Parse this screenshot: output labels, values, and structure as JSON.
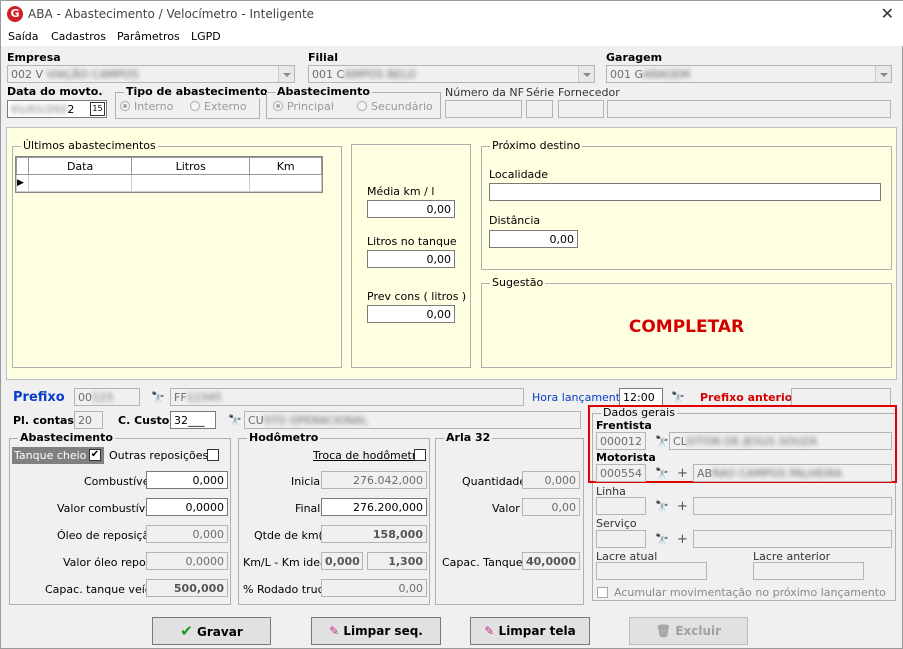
{
  "window": {
    "title": "ABA - Abastecimento / Velocímetro - Inteligente",
    "logo": "G",
    "close": "✕"
  },
  "menu": [
    "Saída",
    "Cadastros",
    "Parâmetros",
    "LGPD"
  ],
  "header": {
    "empresa_label": "Empresa",
    "empresa_value": "002 V",
    "filial_label": "Filial",
    "filial_value": "001 C",
    "garagem_label": "Garagem",
    "garagem_value": "001 G",
    "data_label": "Data do movto.",
    "data_value": "2",
    "tipo_label": "Tipo de abastecimento",
    "tipo_interno": "Interno",
    "tipo_externo": "Externo",
    "abast_label": "Abastecimento",
    "abast_principal": "Principal",
    "abast_secundario": "Secundário",
    "nf_label": "Número da NF",
    "serie_label": "Série",
    "fornecedor_label": "Fornecedor"
  },
  "ultimos": {
    "title": "Últimos abastecimentos",
    "columns": [
      "Data",
      "Litros",
      "Km"
    ]
  },
  "medias": {
    "media_label": "Média km / l",
    "media_value": "0,00",
    "litros_label": "Litros no tanque",
    "litros_value": "0,00",
    "prev_label": "Prev cons ( litros )",
    "prev_value": "0,00"
  },
  "destino": {
    "title": "Próximo destino",
    "localidade_label": "Localidade",
    "distancia_label": "Distância",
    "distancia_value": "0,00"
  },
  "sugestao": {
    "title": "Sugestão",
    "text": "COMPLETAR"
  },
  "prefixo": {
    "label": "Prefixo",
    "value": "00",
    "name": "FF",
    "hora_label": "Hora lançamento",
    "hora_value": "12:00",
    "anterior_label": "Prefixo anterior"
  },
  "contas": {
    "pl_label": "Pl. contas",
    "pl_value": "20",
    "custo_label": "C. Custo",
    "custo_value": "32___",
    "custo_name": "CU"
  },
  "abastecimento": {
    "title": "Abastecimento",
    "tanque_cheio": "Tanque cheio",
    "outras": "Outras reposições",
    "combustivel_label": "Combustível",
    "combustivel_value": "0,000",
    "valor_comb_label": "Valor combustível",
    "valor_comb_value": "0,0000",
    "oleo_label": "Óleo de reposição",
    "oleo_value": "0,000",
    "valor_oleo_label": "Valor óleo repos.",
    "valor_oleo_value": "0,0000",
    "capac_label": "Capac. tanque veíc.",
    "capac_value": "500,000"
  },
  "hodometro": {
    "title": "Hodômetro",
    "troca": "Troca de hodômetro",
    "inicial_label": "Inicial",
    "inicial_value": "276.042,000",
    "final_label": "Final",
    "final_value": "276.200,000",
    "qtde_label": "Qtde de km(s)",
    "qtde_value": "158,000",
    "kml_label": "Km/L - Km ideal",
    "kml_value": "0,000",
    "ideal_value": "1,300",
    "rodado_label": "% Rodado truck",
    "rodado_value": "0,00"
  },
  "arla": {
    "title": "Arla 32",
    "quantidade_label": "Quantidade",
    "quantidade_value": "0,000",
    "valor_label": "Valor",
    "valor_value": "0,00",
    "capac_label": "Capac. Tanque",
    "capac_value": "40,0000"
  },
  "dados": {
    "title": "Dados gerais",
    "frentista_label": "Frentista",
    "frentista_code": "000012",
    "frentista_name": "CL",
    "motorista_label": "Motorista",
    "motorista_code": "000554",
    "motorista_name": "AB",
    "linha_label": "Linha",
    "servico_label": "Serviço",
    "lacre_atual_label": "Lacre atual",
    "lacre_anterior_label": "Lacre anterior",
    "acumular": "Acumular movimentação no próximo lançamento"
  },
  "buttons": {
    "gravar": "Gravar",
    "limpar_seq": "Limpar seq.",
    "limpar_tela": "Limpar tela",
    "excluir": "Excluir"
  },
  "colors": {
    "highlight": "#e00000",
    "panel": "#ffffe1",
    "sugestao_text": "#e00000",
    "label_blue": "#0a3ec8"
  }
}
